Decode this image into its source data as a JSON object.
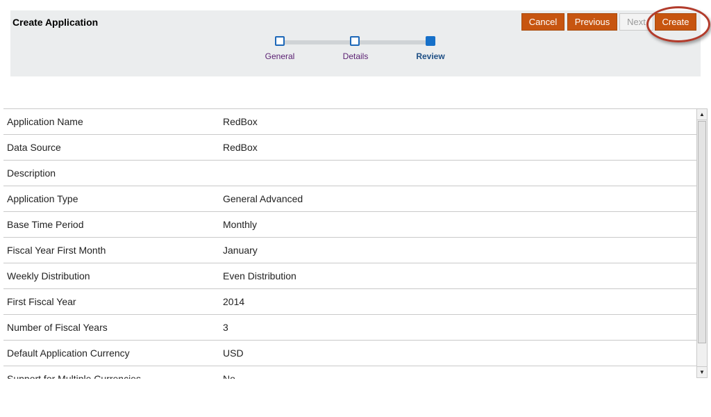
{
  "header": {
    "title": "Create Application",
    "buttons": {
      "cancel": "Cancel",
      "previous": "Previous",
      "next": "Next",
      "create": "Create"
    },
    "steps": [
      {
        "label": "General",
        "state": "visited"
      },
      {
        "label": "Details",
        "state": "visited"
      },
      {
        "label": "Review",
        "state": "current"
      }
    ]
  },
  "review": {
    "rows": [
      {
        "label": "Application Name",
        "value": "RedBox"
      },
      {
        "label": "Data Source",
        "value": "RedBox"
      },
      {
        "label": "Description",
        "value": ""
      },
      {
        "label": "Application Type",
        "value": "General Advanced"
      },
      {
        "label": "Base Time Period",
        "value": "Monthly"
      },
      {
        "label": "Fiscal Year First Month",
        "value": "January"
      },
      {
        "label": "Weekly Distribution",
        "value": "Even Distribution"
      },
      {
        "label": "First Fiscal Year",
        "value": "2014"
      },
      {
        "label": "Number of Fiscal Years",
        "value": "3"
      },
      {
        "label": "Default Application Currency",
        "value": "USD"
      },
      {
        "label": "Support for Multiple Currencies",
        "value": "No"
      }
    ]
  },
  "colors": {
    "accent": "#c75510",
    "highlight_ring": "#b23b2b",
    "step_current": "#1670c9"
  },
  "icons": {
    "scroll_up": "triangle-up-icon",
    "scroll_down": "triangle-down-icon"
  }
}
